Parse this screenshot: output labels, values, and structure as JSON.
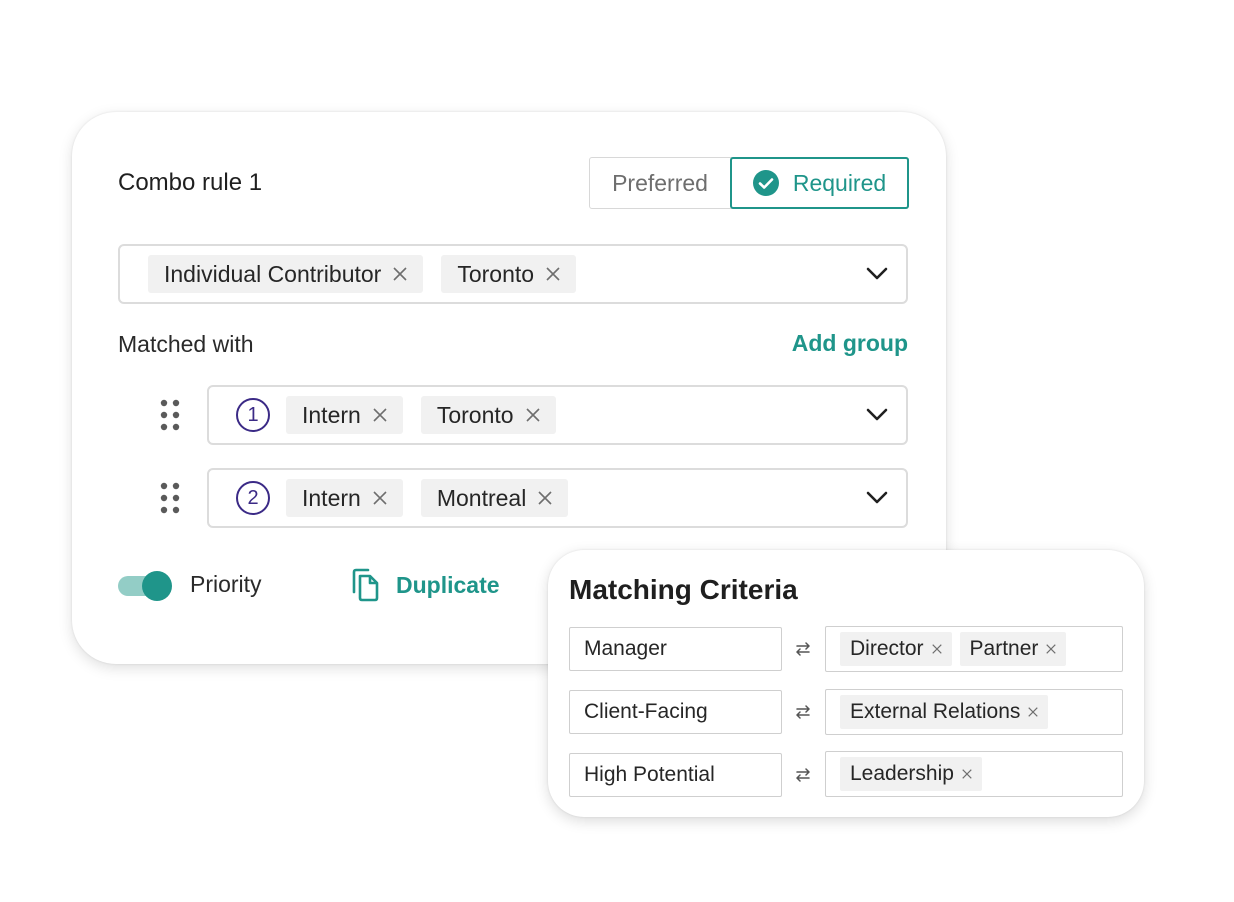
{
  "combo": {
    "title": "Combo rule 1",
    "toggle_preferred": "Preferred",
    "toggle_required": "Required",
    "selected_mode": "Required",
    "main_chips": [
      "Individual Contributor",
      "Toronto"
    ],
    "matched_label": "Matched with",
    "add_group_label": "Add group",
    "groups": [
      {
        "number": "1",
        "chips": [
          "Intern",
          "Toronto"
        ]
      },
      {
        "number": "2",
        "chips": [
          "Intern",
          "Montreal"
        ]
      }
    ],
    "priority_label": "Priority",
    "priority_on": true,
    "duplicate_label": "Duplicate"
  },
  "matching": {
    "title": "Matching Criteria",
    "rows": [
      {
        "left": "Manager",
        "chips": [
          "Director",
          "Partner"
        ]
      },
      {
        "left": "Client-Facing",
        "chips": [
          "External Relations"
        ]
      },
      {
        "left": "High Potential",
        "chips": [
          "Leadership"
        ]
      }
    ]
  },
  "colors": {
    "accent": "#1f958a",
    "accent_light": "#93cdc6",
    "number_circle": "#3b2a86",
    "chip_bg": "#f1f1f1"
  },
  "icons": {
    "required_check": "check-circle-icon",
    "chip_remove": "close-icon",
    "dropdown": "chevron-down-icon",
    "drag": "drag-handle-icon",
    "duplicate": "copy-icon",
    "swap": "swap-arrows-icon"
  }
}
